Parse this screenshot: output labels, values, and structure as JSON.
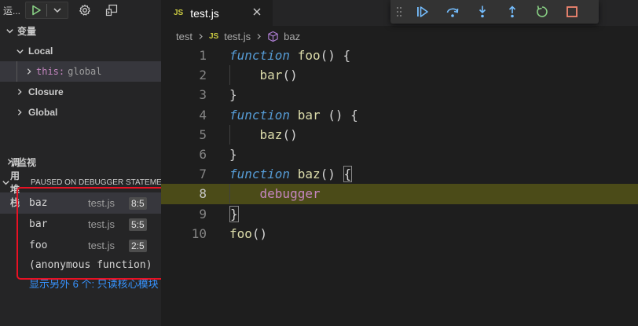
{
  "sidebar": {
    "run_label": "运...",
    "variables": {
      "title": "变量",
      "scopes": [
        {
          "label": "Local",
          "expanded": true
        },
        {
          "label": "Closure",
          "expanded": false
        },
        {
          "label": "Global",
          "expanded": false
        }
      ],
      "local_var": {
        "key": "this:",
        "value": "global"
      }
    },
    "watch": {
      "title": "监视"
    },
    "call_stack": {
      "title": "调用堆栈",
      "status": "PAUSED ON DEBUGGER STATEMENT",
      "frames": [
        {
          "fn": "baz",
          "file": "test.js",
          "pos": "8:5"
        },
        {
          "fn": "bar",
          "file": "test.js",
          "pos": "5:5"
        },
        {
          "fn": "foo",
          "file": "test.js",
          "pos": "2:5"
        }
      ],
      "anonymous": "(anonymous function)",
      "show_more": "显示另外 6 个: 只读核心模块"
    }
  },
  "editor": {
    "tab": {
      "icon": "JS",
      "label": "test.js"
    },
    "breadcrumb": {
      "folder": "test",
      "file": "test.js",
      "symbol": "baz"
    },
    "lines": [
      {
        "n": "1",
        "t": [
          [
            "kw",
            "function"
          ],
          [
            "sp",
            " "
          ],
          [
            "fnname",
            "foo"
          ],
          [
            "punc",
            "() {"
          ]
        ]
      },
      {
        "n": "2",
        "t": [
          [
            "sp",
            "    "
          ],
          [
            "call",
            "bar"
          ],
          [
            "punc",
            "()"
          ]
        ]
      },
      {
        "n": "3",
        "t": [
          [
            "punc",
            "}"
          ]
        ]
      },
      {
        "n": "4",
        "t": [
          [
            "kw",
            "function"
          ],
          [
            "sp",
            " "
          ],
          [
            "fnname",
            "bar"
          ],
          [
            "punc",
            " () {"
          ]
        ]
      },
      {
        "n": "5",
        "t": [
          [
            "sp",
            "    "
          ],
          [
            "call",
            "baz"
          ],
          [
            "punc",
            "()"
          ]
        ]
      },
      {
        "n": "6",
        "t": [
          [
            "punc",
            "}"
          ]
        ]
      },
      {
        "n": "7",
        "t": [
          [
            "kw",
            "function"
          ],
          [
            "sp",
            " "
          ],
          [
            "fnname",
            "baz"
          ],
          [
            "punc",
            "() "
          ],
          [
            "box",
            "{"
          ]
        ]
      },
      {
        "n": "8",
        "t": [
          [
            "sp",
            "    "
          ],
          [
            "dbg",
            "debugger"
          ]
        ]
      },
      {
        "n": "9",
        "t": [
          [
            "box",
            "}"
          ]
        ]
      },
      {
        "n": "10",
        "t": [
          [
            "call",
            "foo"
          ],
          [
            "punc",
            "()"
          ]
        ]
      }
    ],
    "current_line": "8"
  },
  "colors": {
    "accent_blue": "#75beff",
    "green": "#89d185",
    "stop_red": "#f48771",
    "highlight_border": "#e81123"
  },
  "icons": [
    "play-icon",
    "chevron-down-icon",
    "gear-icon",
    "debug-console-icon",
    "close-icon",
    "js-file-icon",
    "cube-icon",
    "grip-icon",
    "continue-icon",
    "step-over-icon",
    "step-into-icon",
    "step-out-icon",
    "restart-icon",
    "stop-icon"
  ]
}
